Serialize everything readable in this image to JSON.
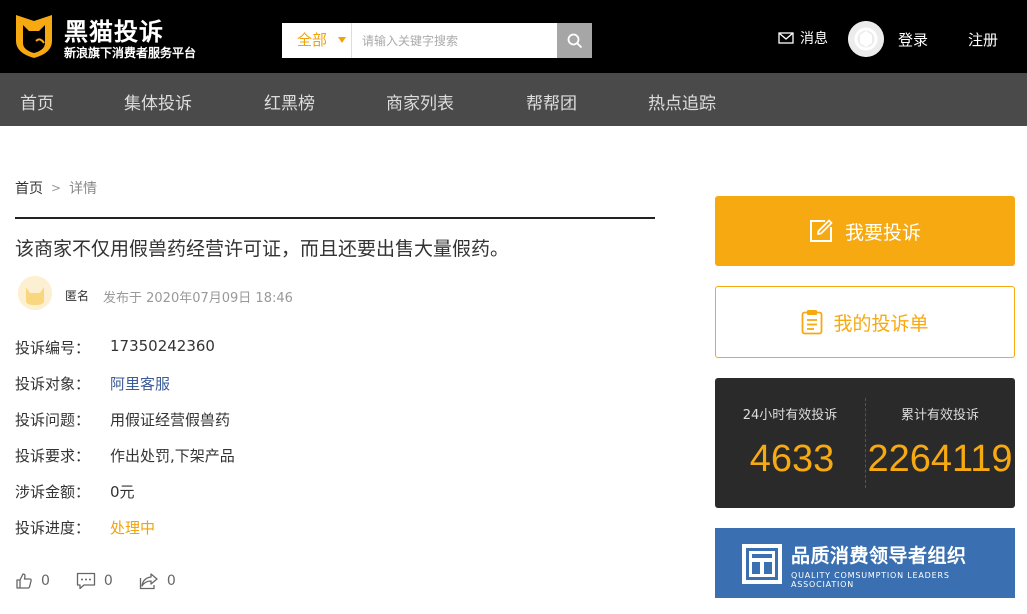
{
  "header": {
    "logo_title": "黑猫投诉",
    "logo_subtitle": "新浪旗下消费者服务平台",
    "search": {
      "category": "全部",
      "placeholder": "请输入关键字搜索"
    },
    "message_label": "消息",
    "login_label": "登录",
    "register_label": "注册"
  },
  "nav": {
    "items": [
      {
        "label": "首页"
      },
      {
        "label": "集体投诉"
      },
      {
        "label": "红黑榜"
      },
      {
        "label": "商家列表"
      },
      {
        "label": "帮帮团"
      },
      {
        "label": "热点追踪"
      }
    ]
  },
  "breadcrumb": {
    "home": "首页",
    "separator": ">",
    "current": "详情"
  },
  "complaint": {
    "title": "该商家不仅用假兽药经营许可证，而且还要出售大量假药。",
    "author": "匿名",
    "published": "发布于 2020年07月09日 18:46",
    "fields": [
      {
        "key": "投诉编号：",
        "value": "17350242360"
      },
      {
        "key": "投诉对象：",
        "value": "阿里客服"
      },
      {
        "key": "投诉问题：",
        "value": "用假证经营假兽药"
      },
      {
        "key": "投诉要求：",
        "value": "作出处罚,下架产品"
      },
      {
        "key": "涉诉金额：",
        "value": "0元"
      },
      {
        "key": "投诉进度：",
        "value": "处理中"
      }
    ],
    "actions": {
      "likes": "0",
      "comments": "0",
      "shares": "0"
    }
  },
  "sidebar": {
    "complain_button": "我要投诉",
    "my_list_button": "我的投诉单",
    "stats": {
      "left_label": "24小时有效投诉",
      "left_value": "4633",
      "right_label": "累计有效投诉",
      "right_value": "2264119"
    },
    "banner": {
      "title": "品质消费领导者组织",
      "subtitle": "QUALITY COMSUMPTION LEADERS ASSOCIATION"
    }
  },
  "colors": {
    "accent": "#f7a912",
    "header_bg": "#000000",
    "nav_bg": "#4a4a4a",
    "link": "#3a5a99",
    "banner_bg": "#3a6fb1"
  }
}
